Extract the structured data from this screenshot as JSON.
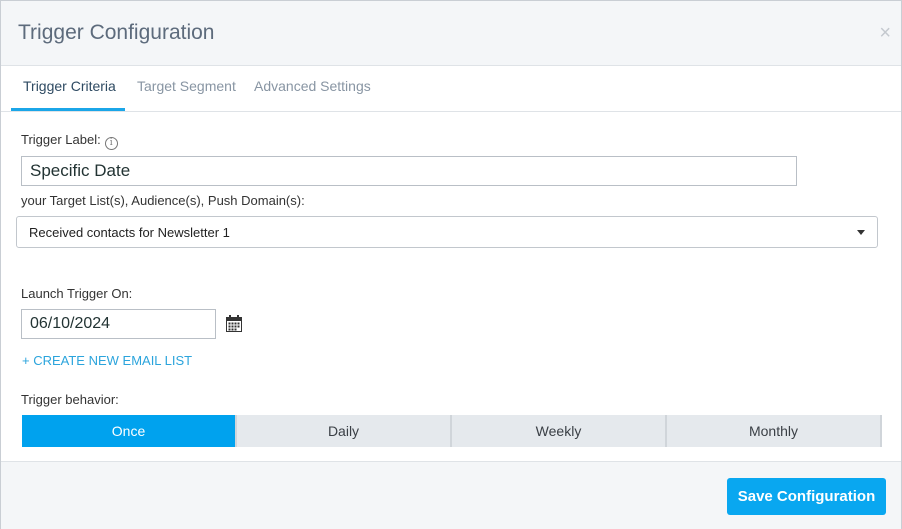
{
  "modal": {
    "title": "Trigger Configuration",
    "close_symbol": "×"
  },
  "tabs": [
    {
      "label": "Trigger Criteria",
      "active": true
    },
    {
      "label": "Target Segment",
      "active": false
    },
    {
      "label": "Advanced Settings",
      "active": false
    }
  ],
  "form": {
    "trigger_label": {
      "label": "Trigger Label:",
      "info_icon": "info-icon",
      "value": "Specific Date"
    },
    "target_list": {
      "label": "your Target List(s), Audience(s), Push Domain(s):",
      "selected": "Received contacts for Newsletter 1"
    },
    "launch_trigger": {
      "label": "Launch Trigger On:",
      "date_value": "06/10/2024",
      "calendar_icon": "calendar-icon"
    },
    "create_link": "+ CREATE NEW EMAIL LIST",
    "behavior": {
      "label": "Trigger behavior:",
      "options": [
        "Once",
        "Daily",
        "Weekly",
        "Monthly"
      ],
      "selected": "Once"
    }
  },
  "footer": {
    "save_label": "Save Configuration"
  },
  "colors": {
    "accent": "#00a2ee",
    "link": "#2ba4dc",
    "header_bg": "#f4f6f8",
    "tab_inactive": "#8895a3",
    "tab_active": "#2e4a62"
  }
}
